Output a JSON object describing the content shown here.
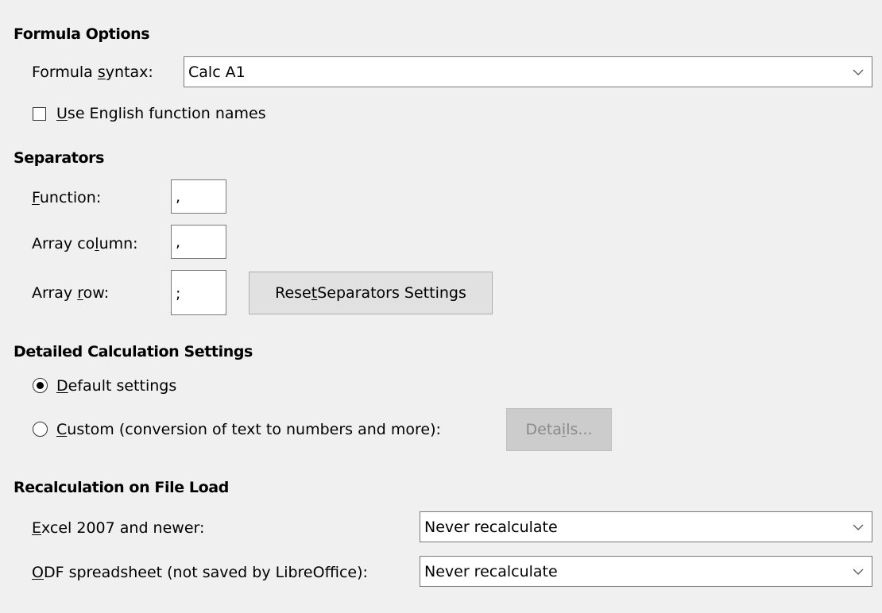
{
  "formula_options": {
    "title": "Formula Options",
    "syntax_label_pre": "Formula ",
    "syntax_label_key": "s",
    "syntax_label_post": "yntax:",
    "syntax_value": "Calc A1",
    "english_names_key": "U",
    "english_names_post": "se English function names",
    "english_names_checked": false
  },
  "separators": {
    "title": "Separators",
    "function_key": "F",
    "function_post": "unction:",
    "function_value": ",",
    "array_column_pre": "Array co",
    "array_column_key": "l",
    "array_column_post": "umn:",
    "array_column_value": ",",
    "array_row_pre": "Array ",
    "array_row_key": "r",
    "array_row_post": "ow:",
    "array_row_value": ";",
    "reset_pre": "Rese",
    "reset_key": "t",
    "reset_post": " Separators Settings"
  },
  "detailed_calc": {
    "title": "Detailed Calculation Settings",
    "default_key": "D",
    "default_post": "efault settings",
    "default_selected": true,
    "custom_key": "C",
    "custom_post": "ustom (conversion of text to numbers and more):",
    "custom_selected": false,
    "details_pre": "Deta",
    "details_key": "i",
    "details_post": "ls..."
  },
  "recalculation": {
    "title": "Recalculation on File Load",
    "excel_key": "E",
    "excel_post": "xcel 2007 and newer:",
    "excel_value": "Never recalculate",
    "odf_key": "O",
    "odf_post": "DF spreadsheet (not saved by LibreOffice):",
    "odf_value": "Never recalculate"
  },
  "icons": {
    "dropdown": "chevron-down-icon"
  }
}
